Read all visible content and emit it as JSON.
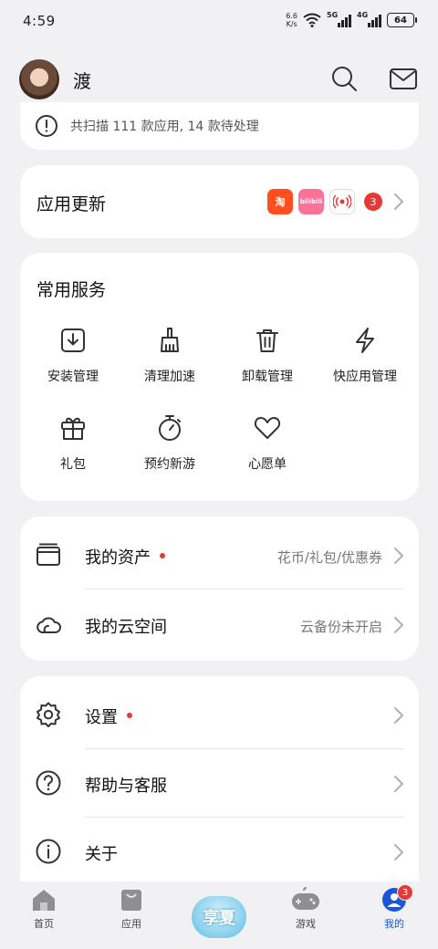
{
  "status_bar": {
    "time": "4:59",
    "net_speed_value": "6.6",
    "net_speed_unit": "K/s",
    "sig1": "5G",
    "sig2": "4G",
    "battery": "64"
  },
  "header": {
    "username": "渡"
  },
  "scan": {
    "text": "共扫描 111 款应用, 14 款待处理"
  },
  "updates": {
    "title": "应用更新",
    "apps": [
      "taobao",
      "bilibili",
      "radio"
    ],
    "taobao_label": "淘",
    "bili_label": "bilibili",
    "count": "3"
  },
  "services": {
    "title": "常用服务",
    "items": [
      {
        "label": "安装管理",
        "icon": "install-icon"
      },
      {
        "label": "清理加速",
        "icon": "broom-icon"
      },
      {
        "label": "卸载管理",
        "icon": "trash-icon"
      },
      {
        "label": "快应用管理",
        "icon": "bolt-icon"
      },
      {
        "label": "礼包",
        "icon": "gift-icon"
      },
      {
        "label": "预约新游",
        "icon": "timer-icon"
      },
      {
        "label": "心愿单",
        "icon": "heart-icon"
      }
    ]
  },
  "assets": {
    "rows": [
      {
        "label": "我的资产",
        "value": "花币/礼包/优惠券",
        "dot": true
      },
      {
        "label": "我的云空间",
        "value": "云备份未开启",
        "dot": false
      }
    ]
  },
  "settings": {
    "rows": [
      {
        "label": "设置",
        "dot": true
      },
      {
        "label": "帮助与客服",
        "dot": false
      },
      {
        "label": "关于",
        "dot": false
      }
    ]
  },
  "nav": {
    "items": [
      {
        "label": "首页"
      },
      {
        "label": "应用"
      },
      {
        "label": "游戏"
      },
      {
        "label": "我的"
      }
    ],
    "promo_text": "享夏",
    "profile_badge": "3",
    "active_color": "#1a56d6"
  }
}
